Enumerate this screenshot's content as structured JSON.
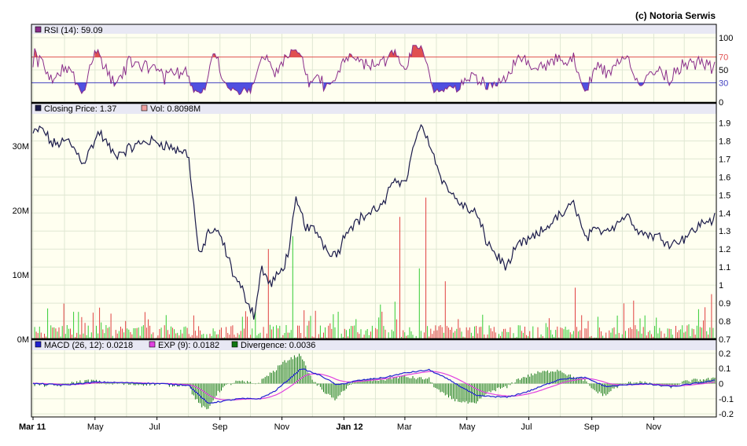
{
  "copyright": "(c) Notoria Serwis",
  "colors": {
    "plot_bg": "#fffff0",
    "legend_bg": "#e8e8f4",
    "grid": "#dfe7d3",
    "rsi_line": "#8a2d8a",
    "rsi_overbought_fill": "#e05050",
    "rsi_oversold_fill": "#5050e0",
    "rsi_70_line": "#e05050",
    "rsi_30_line": "#4040c0",
    "price_line": "#1a1a4a",
    "volume_up": "#33cc33",
    "volume_down": "#e04040",
    "macd_line": "#2020d0",
    "exp_line": "#e040e0",
    "divergence_bar": "#117711"
  },
  "x_axis": {
    "ticks": [
      "Mar 11",
      "May",
      "Jul",
      "Sep",
      "Nov",
      "Jan 12",
      "Mar",
      "May",
      "Jul",
      "Sep",
      "Nov"
    ],
    "bold_ticks": [
      "Mar 11",
      "Jan 12"
    ]
  },
  "panels": {
    "rsi": {
      "legend": [
        {
          "label": "RSI (14): 59.09",
          "color": "#8a2d8a"
        }
      ],
      "y_ticks": [
        "100",
        "70",
        "50",
        "30",
        "0"
      ],
      "ref_labels": {
        "upper": "70",
        "lower": "30"
      }
    },
    "price": {
      "legend": [
        {
          "label": "Closing Price: 1.37",
          "color": "#1a1a4a"
        },
        {
          "label": "Vol: 0.8098M",
          "color": "#f0a0a0"
        }
      ],
      "y_ticks": [
        "1.9",
        "1.8",
        "1.7",
        "1.6",
        "1.5",
        "1.4",
        "1.3",
        "1.2",
        "1.1",
        "1",
        "0.9",
        "0.8",
        "0.7"
      ],
      "volume_ticks": [
        "30M",
        "20M",
        "10M",
        "0M"
      ]
    },
    "macd": {
      "legend": [
        {
          "label": "MACD (26, 12): 0.0218",
          "color": "#2020d0"
        },
        {
          "label": "EXP (9): 0.0182",
          "color": "#e040e0"
        },
        {
          "label": "Divergence: 0.0036",
          "color": "#117711"
        }
      ],
      "y_ticks": [
        "0.2",
        "0.1",
        "0",
        "-0.1",
        "-0.2"
      ]
    }
  },
  "chart_data": {
    "type": "line",
    "x_range": [
      "2011-03-01",
      "2012-12-31"
    ],
    "price": {
      "ylim": [
        0.7,
        1.95
      ],
      "anchors": [
        [
          "2011-03-01",
          1.84
        ],
        [
          "2011-03-10",
          1.87
        ],
        [
          "2011-03-20",
          1.78
        ],
        [
          "2011-04-05",
          1.8
        ],
        [
          "2011-04-20",
          1.68
        ],
        [
          "2011-05-05",
          1.85
        ],
        [
          "2011-05-20",
          1.72
        ],
        [
          "2011-06-05",
          1.76
        ],
        [
          "2011-06-20",
          1.8
        ],
        [
          "2011-07-05",
          1.79
        ],
        [
          "2011-07-20",
          1.75
        ],
        [
          "2011-08-01",
          1.73
        ],
        [
          "2011-08-05",
          1.5
        ],
        [
          "2011-08-12",
          1.14
        ],
        [
          "2011-08-20",
          1.3
        ],
        [
          "2011-09-01",
          1.28
        ],
        [
          "2011-09-15",
          1.05
        ],
        [
          "2011-09-25",
          0.95
        ],
        [
          "2011-10-05",
          0.83
        ],
        [
          "2011-10-12",
          1.1
        ],
        [
          "2011-10-20",
          1.0
        ],
        [
          "2011-11-01",
          1.08
        ],
        [
          "2011-11-08",
          1.2
        ],
        [
          "2011-11-15",
          1.47
        ],
        [
          "2011-11-25",
          1.32
        ],
        [
          "2011-12-05",
          1.3
        ],
        [
          "2011-12-15",
          1.2
        ],
        [
          "2011-12-25",
          1.17
        ],
        [
          "2012-01-05",
          1.32
        ],
        [
          "2012-01-20",
          1.38
        ],
        [
          "2012-02-01",
          1.42
        ],
        [
          "2012-02-10",
          1.45
        ],
        [
          "2012-02-20",
          1.6
        ],
        [
          "2012-03-01",
          1.56
        ],
        [
          "2012-03-15",
          1.88
        ],
        [
          "2012-03-25",
          1.8
        ],
        [
          "2012-04-01",
          1.67
        ],
        [
          "2012-04-10",
          1.55
        ],
        [
          "2012-04-20",
          1.48
        ],
        [
          "2012-05-01",
          1.42
        ],
        [
          "2012-05-10",
          1.4
        ],
        [
          "2012-05-20",
          1.25
        ],
        [
          "2012-06-01",
          1.15
        ],
        [
          "2012-06-10",
          1.1
        ],
        [
          "2012-06-20",
          1.22
        ],
        [
          "2012-07-05",
          1.26
        ],
        [
          "2012-07-15",
          1.3
        ],
        [
          "2012-07-25",
          1.36
        ],
        [
          "2012-08-05",
          1.4
        ],
        [
          "2012-08-15",
          1.46
        ],
        [
          "2012-08-25",
          1.26
        ],
        [
          "2012-09-05",
          1.3
        ],
        [
          "2012-09-20",
          1.32
        ],
        [
          "2012-10-05",
          1.39
        ],
        [
          "2012-10-20",
          1.29
        ],
        [
          "2012-11-05",
          1.27
        ],
        [
          "2012-11-20",
          1.23
        ],
        [
          "2012-12-05",
          1.28
        ],
        [
          "2012-12-20",
          1.35
        ],
        [
          "2012-12-31",
          1.37
        ]
      ]
    },
    "volume": {
      "ylim": [
        0,
        35
      ],
      "spikes": [
        [
          "2011-10-18",
          14
        ],
        [
          "2011-11-12",
          16
        ],
        [
          "2012-02-25",
          19
        ],
        [
          "2012-03-15",
          11
        ],
        [
          "2012-03-22",
          22
        ],
        [
          "2012-04-10",
          9
        ],
        [
          "2012-08-15",
          8
        ],
        [
          "2012-10-12",
          6
        ],
        [
          "2012-12-28",
          7
        ]
      ]
    },
    "rsi": {
      "ylim": [
        0,
        100
      ],
      "overbought": 70,
      "oversold": 30
    },
    "macd": {
      "ylim": [
        -0.22,
        0.22
      ],
      "anchors": [
        [
          "2011-03-01",
          0.0
        ],
        [
          "2011-04-01",
          -0.01
        ],
        [
          "2011-05-01",
          0.01
        ],
        [
          "2011-07-01",
          0.0
        ],
        [
          "2011-08-01",
          -0.01
        ],
        [
          "2011-08-20",
          -0.13
        ],
        [
          "2011-09-20",
          -0.1
        ],
        [
          "2011-10-10",
          -0.1
        ],
        [
          "2011-10-25",
          -0.05
        ],
        [
          "2011-11-10",
          0.04
        ],
        [
          "2011-11-20",
          0.1
        ],
        [
          "2011-12-10",
          0.05
        ],
        [
          "2011-12-25",
          -0.01
        ],
        [
          "2012-01-15",
          0.02
        ],
        [
          "2012-02-10",
          0.04
        ],
        [
          "2012-03-01",
          0.07
        ],
        [
          "2012-03-25",
          0.09
        ],
        [
          "2012-04-15",
          0.02
        ],
        [
          "2012-05-10",
          -0.08
        ],
        [
          "2012-06-10",
          -0.09
        ],
        [
          "2012-07-01",
          -0.05
        ],
        [
          "2012-08-01",
          0.03
        ],
        [
          "2012-08-25",
          0.04
        ],
        [
          "2012-09-15",
          -0.02
        ],
        [
          "2012-10-20",
          0.0
        ],
        [
          "2012-11-20",
          -0.02
        ],
        [
          "2012-12-31",
          0.02
        ]
      ]
    }
  }
}
